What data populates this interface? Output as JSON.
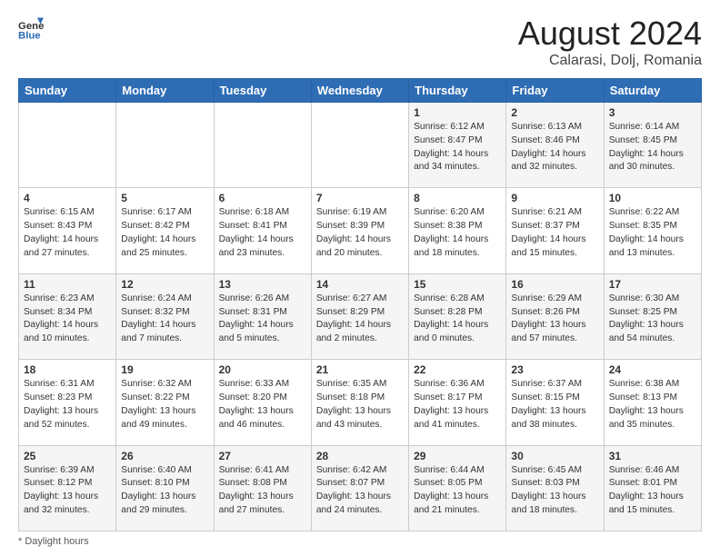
{
  "header": {
    "logo_general": "General",
    "logo_blue": "Blue",
    "month_year": "August 2024",
    "location": "Calarasi, Dolj, Romania"
  },
  "days_of_week": [
    "Sunday",
    "Monday",
    "Tuesday",
    "Wednesday",
    "Thursday",
    "Friday",
    "Saturday"
  ],
  "weeks": [
    [
      {
        "day": "",
        "info": ""
      },
      {
        "day": "",
        "info": ""
      },
      {
        "day": "",
        "info": ""
      },
      {
        "day": "",
        "info": ""
      },
      {
        "day": "1",
        "info": "Sunrise: 6:12 AM\nSunset: 8:47 PM\nDaylight: 14 hours\nand 34 minutes."
      },
      {
        "day": "2",
        "info": "Sunrise: 6:13 AM\nSunset: 8:46 PM\nDaylight: 14 hours\nand 32 minutes."
      },
      {
        "day": "3",
        "info": "Sunrise: 6:14 AM\nSunset: 8:45 PM\nDaylight: 14 hours\nand 30 minutes."
      }
    ],
    [
      {
        "day": "4",
        "info": "Sunrise: 6:15 AM\nSunset: 8:43 PM\nDaylight: 14 hours\nand 27 minutes."
      },
      {
        "day": "5",
        "info": "Sunrise: 6:17 AM\nSunset: 8:42 PM\nDaylight: 14 hours\nand 25 minutes."
      },
      {
        "day": "6",
        "info": "Sunrise: 6:18 AM\nSunset: 8:41 PM\nDaylight: 14 hours\nand 23 minutes."
      },
      {
        "day": "7",
        "info": "Sunrise: 6:19 AM\nSunset: 8:39 PM\nDaylight: 14 hours\nand 20 minutes."
      },
      {
        "day": "8",
        "info": "Sunrise: 6:20 AM\nSunset: 8:38 PM\nDaylight: 14 hours\nand 18 minutes."
      },
      {
        "day": "9",
        "info": "Sunrise: 6:21 AM\nSunset: 8:37 PM\nDaylight: 14 hours\nand 15 minutes."
      },
      {
        "day": "10",
        "info": "Sunrise: 6:22 AM\nSunset: 8:35 PM\nDaylight: 14 hours\nand 13 minutes."
      }
    ],
    [
      {
        "day": "11",
        "info": "Sunrise: 6:23 AM\nSunset: 8:34 PM\nDaylight: 14 hours\nand 10 minutes."
      },
      {
        "day": "12",
        "info": "Sunrise: 6:24 AM\nSunset: 8:32 PM\nDaylight: 14 hours\nand 7 minutes."
      },
      {
        "day": "13",
        "info": "Sunrise: 6:26 AM\nSunset: 8:31 PM\nDaylight: 14 hours\nand 5 minutes."
      },
      {
        "day": "14",
        "info": "Sunrise: 6:27 AM\nSunset: 8:29 PM\nDaylight: 14 hours\nand 2 minutes."
      },
      {
        "day": "15",
        "info": "Sunrise: 6:28 AM\nSunset: 8:28 PM\nDaylight: 14 hours\nand 0 minutes."
      },
      {
        "day": "16",
        "info": "Sunrise: 6:29 AM\nSunset: 8:26 PM\nDaylight: 13 hours\nand 57 minutes."
      },
      {
        "day": "17",
        "info": "Sunrise: 6:30 AM\nSunset: 8:25 PM\nDaylight: 13 hours\nand 54 minutes."
      }
    ],
    [
      {
        "day": "18",
        "info": "Sunrise: 6:31 AM\nSunset: 8:23 PM\nDaylight: 13 hours\nand 52 minutes."
      },
      {
        "day": "19",
        "info": "Sunrise: 6:32 AM\nSunset: 8:22 PM\nDaylight: 13 hours\nand 49 minutes."
      },
      {
        "day": "20",
        "info": "Sunrise: 6:33 AM\nSunset: 8:20 PM\nDaylight: 13 hours\nand 46 minutes."
      },
      {
        "day": "21",
        "info": "Sunrise: 6:35 AM\nSunset: 8:18 PM\nDaylight: 13 hours\nand 43 minutes."
      },
      {
        "day": "22",
        "info": "Sunrise: 6:36 AM\nSunset: 8:17 PM\nDaylight: 13 hours\nand 41 minutes."
      },
      {
        "day": "23",
        "info": "Sunrise: 6:37 AM\nSunset: 8:15 PM\nDaylight: 13 hours\nand 38 minutes."
      },
      {
        "day": "24",
        "info": "Sunrise: 6:38 AM\nSunset: 8:13 PM\nDaylight: 13 hours\nand 35 minutes."
      }
    ],
    [
      {
        "day": "25",
        "info": "Sunrise: 6:39 AM\nSunset: 8:12 PM\nDaylight: 13 hours\nand 32 minutes."
      },
      {
        "day": "26",
        "info": "Sunrise: 6:40 AM\nSunset: 8:10 PM\nDaylight: 13 hours\nand 29 minutes."
      },
      {
        "day": "27",
        "info": "Sunrise: 6:41 AM\nSunset: 8:08 PM\nDaylight: 13 hours\nand 27 minutes."
      },
      {
        "day": "28",
        "info": "Sunrise: 6:42 AM\nSunset: 8:07 PM\nDaylight: 13 hours\nand 24 minutes."
      },
      {
        "day": "29",
        "info": "Sunrise: 6:44 AM\nSunset: 8:05 PM\nDaylight: 13 hours\nand 21 minutes."
      },
      {
        "day": "30",
        "info": "Sunrise: 6:45 AM\nSunset: 8:03 PM\nDaylight: 13 hours\nand 18 minutes."
      },
      {
        "day": "31",
        "info": "Sunrise: 6:46 AM\nSunset: 8:01 PM\nDaylight: 13 hours\nand 15 minutes."
      }
    ]
  ],
  "footer": {
    "note": "Daylight hours"
  }
}
